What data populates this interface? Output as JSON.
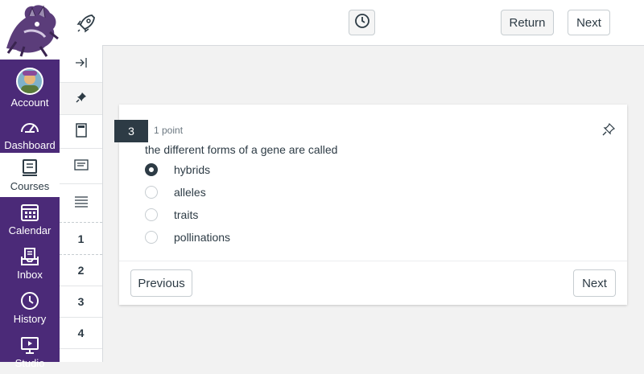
{
  "nav": {
    "items": [
      {
        "label": "Account",
        "icon": "avatar"
      },
      {
        "label": "Dashboard",
        "icon": "dashboard-icon"
      },
      {
        "label": "Courses",
        "icon": "courses-icon",
        "active": true
      },
      {
        "label": "Calendar",
        "icon": "calendar-icon"
      },
      {
        "label": "Inbox",
        "icon": "inbox-icon"
      },
      {
        "label": "History",
        "icon": "history-icon"
      },
      {
        "label": "Studio",
        "icon": "studio-icon"
      }
    ]
  },
  "topbar": {
    "return_label": "Return",
    "next_label": "Next"
  },
  "tray": {
    "numbers": [
      "1",
      "2",
      "3",
      "4"
    ]
  },
  "question": {
    "number": "3",
    "points": "1 point",
    "text": "the different forms of a gene are called",
    "answers": [
      {
        "label": "hybrids",
        "selected": true
      },
      {
        "label": "alleles",
        "selected": false
      },
      {
        "label": "traits",
        "selected": false
      },
      {
        "label": "pollinations",
        "selected": false
      }
    ],
    "previous_label": "Previous",
    "next_label": "Next"
  },
  "colors": {
    "nav_bg": "#4b2a78",
    "text_dark": "#2d3b45",
    "question_badge": "#2d3b45"
  }
}
